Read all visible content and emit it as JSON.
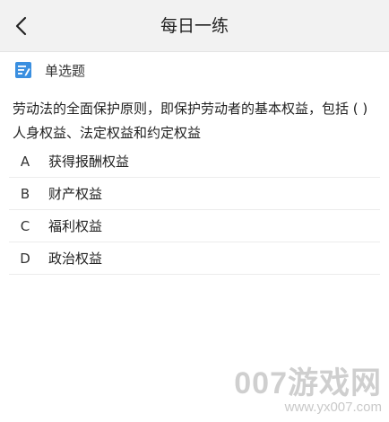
{
  "header": {
    "title": "每日一练",
    "back_icon": "chevron-left-icon"
  },
  "question": {
    "type_icon": "edit-note-icon",
    "type_icon_color": "#3a8fe0",
    "type_label": "单选题",
    "text_line1": "劳动法的全面保护原则，即保护劳动者的基本权益，包括 ( )",
    "text_line2": "人身权益、法定权益和约定权益",
    "options": [
      {
        "letter": "A",
        "text": "获得报酬权益"
      },
      {
        "letter": "B",
        "text": "财产权益"
      },
      {
        "letter": "C",
        "text": "福利权益"
      },
      {
        "letter": "D",
        "text": "政治权益"
      }
    ]
  },
  "watermark": {
    "main": "007游戏网",
    "url": "www.yx007.com"
  }
}
